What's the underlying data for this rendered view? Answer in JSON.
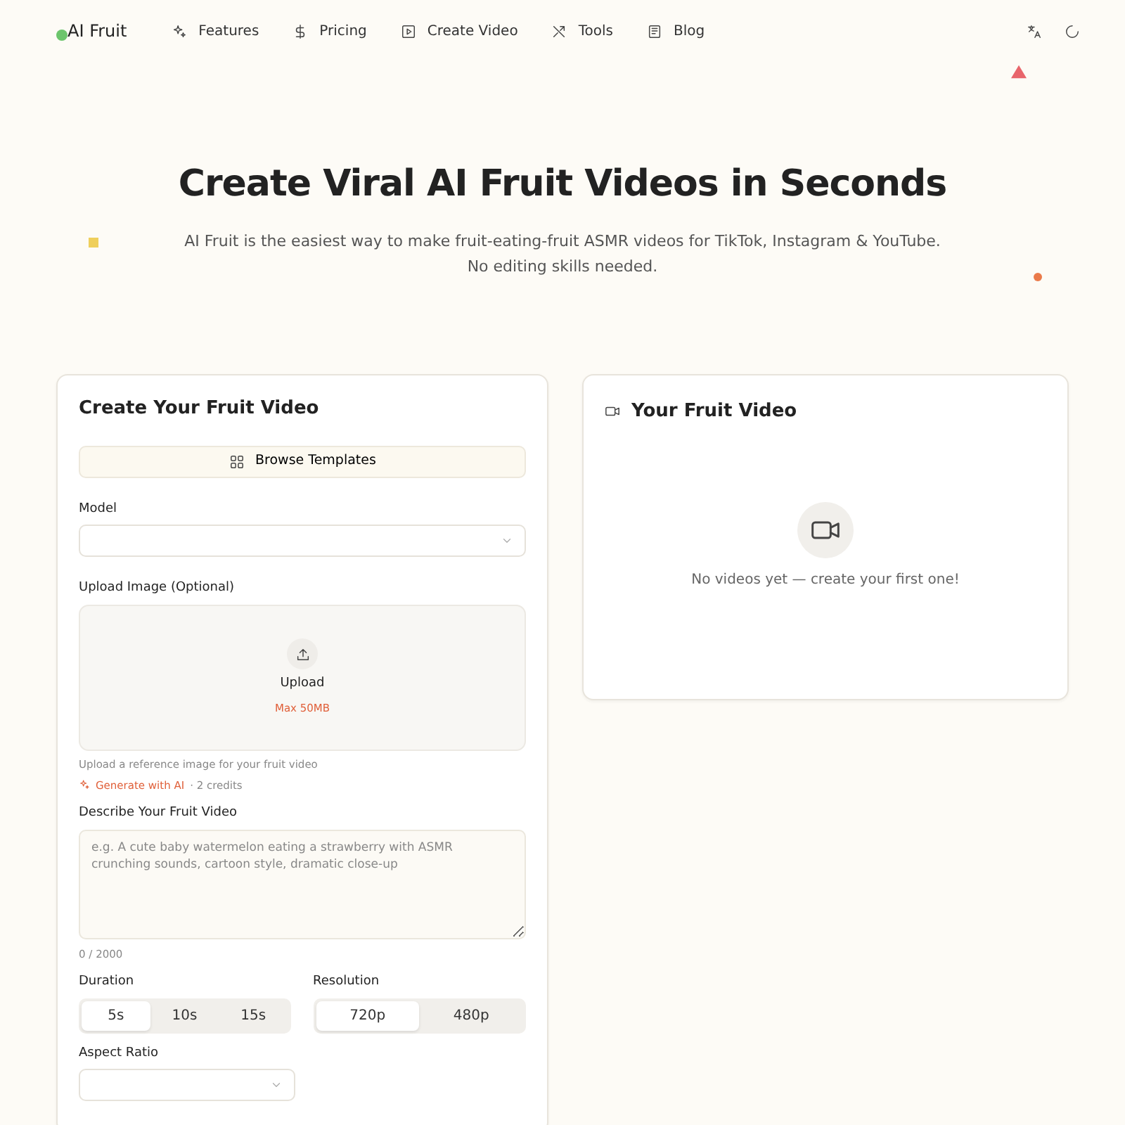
{
  "brand": "AI Fruit",
  "nav": [
    "Features",
    "Pricing",
    "Create Video",
    "Tools",
    "Blog"
  ],
  "hero": {
    "title": "Create Viral AI Fruit Videos in Seconds",
    "subtitle_lines": [
      "AI Fruit is the easiest way to make fruit-eating-fruit ASMR videos for TikTok, Instagram & YouTube.",
      "No editing skills needed."
    ]
  },
  "form": {
    "title": "Create Your Fruit Video",
    "templates_button": "Browse Templates",
    "model_label": "Model",
    "upload_label": "Upload Image (Optional)",
    "upload_text": "Upload",
    "upload_limit": "Max 50MB",
    "upload_help": "Upload a reference image for your fruit video",
    "generate_link": "Generate with AI",
    "generate_cost": "· 2 credits",
    "describe_label": "Describe Your Fruit Video",
    "describe_placeholder": "e.g. A cute baby watermelon eating a strawberry with ASMR crunching sounds, cartoon style, dramatic close-up",
    "char_count": "0 / 2000",
    "duration_label": "Duration",
    "durations": [
      {
        "label": "5s",
        "selected": true
      },
      {
        "label": "10s",
        "selected": false
      },
      {
        "label": "15s",
        "selected": false
      }
    ],
    "resolution_label": "Resolution",
    "resolutions": [
      {
        "label": "720p",
        "selected": true
      },
      {
        "label": "480p",
        "selected": false
      }
    ],
    "aspect_label": "Aspect Ratio"
  },
  "output": {
    "title": "Your Fruit Video",
    "empty_text": "No videos yet — create your first one!"
  }
}
